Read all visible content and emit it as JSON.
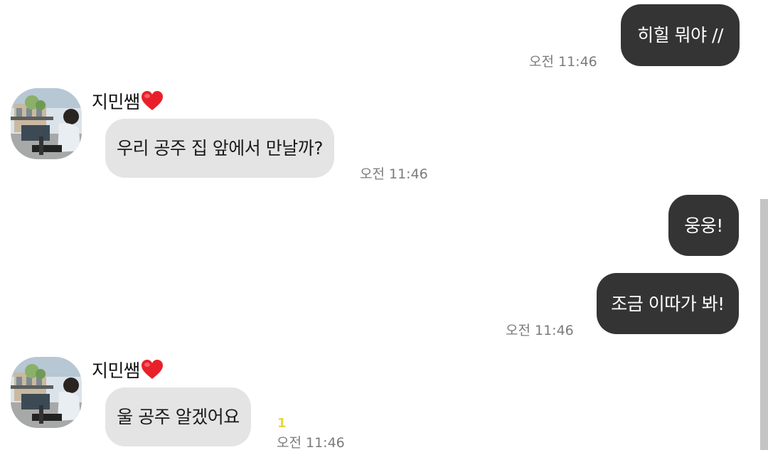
{
  "messages": [
    {
      "id": "m1",
      "direction": "outgoing",
      "text": "히힐 뭐야 //",
      "time": "오전 11:46"
    },
    {
      "id": "m2",
      "direction": "incoming",
      "sender": "지민쌤",
      "text": "우리 공주 집 앞에서 만날까?",
      "time": "오전 11:46"
    },
    {
      "id": "m3",
      "direction": "outgoing",
      "text": "웅웅!"
    },
    {
      "id": "m4",
      "direction": "outgoing",
      "text": "조금 이따가 봐!",
      "time": "오전 11:46"
    },
    {
      "id": "m5",
      "direction": "incoming",
      "sender": "지민쌤",
      "text": "울 공주 알겠어요",
      "unread": "1",
      "time": "오전 11:46"
    }
  ],
  "icons": {
    "heart": "heart-icon",
    "avatar": "profile-photo"
  },
  "colors": {
    "outgoing_bubble": "#333433",
    "incoming_bubble": "#e4e4e4",
    "timestamp": "#7b7b7b",
    "unread_badge": "#e8d542",
    "heart": "#e8202a"
  }
}
